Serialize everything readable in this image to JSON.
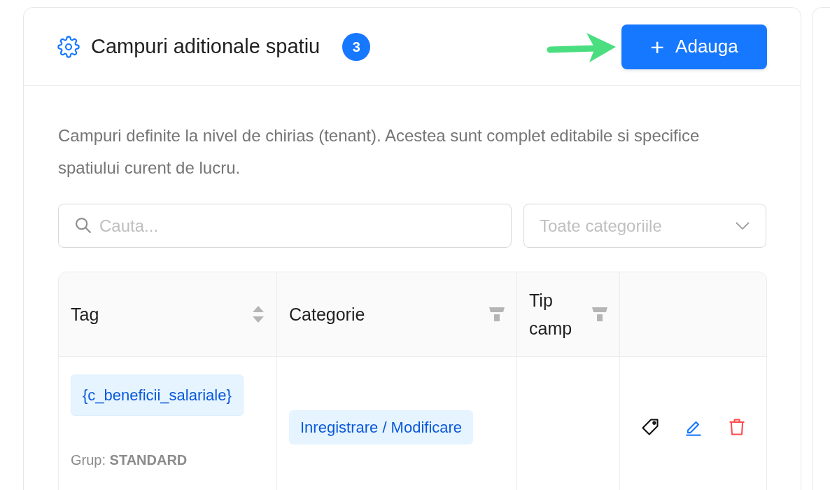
{
  "card": {
    "title": "Campuri aditionale spatiu",
    "count": "3",
    "add_button": {
      "icon": "+",
      "label": "Adauga"
    },
    "description": "Campuri definite la nivel de chirias (tenant). Acestea sunt complet editabile si specifice spatiului curent de lucru.",
    "search": {
      "placeholder": "Cauta..."
    },
    "category_select": {
      "placeholder": "Toate categoriile"
    },
    "table": {
      "columns": [
        {
          "label": "Tag",
          "kind": "sort"
        },
        {
          "label": "Categorie",
          "kind": "filter"
        },
        {
          "label": "Tip camp",
          "kind": "filter"
        },
        {
          "kind": "actions"
        }
      ],
      "rows": [
        {
          "tag": "{c_beneficii_salariale}",
          "group": "Grup: **STANDARD**",
          "category": "Inregistrare / Modificare"
        }
      ]
    }
  }
}
